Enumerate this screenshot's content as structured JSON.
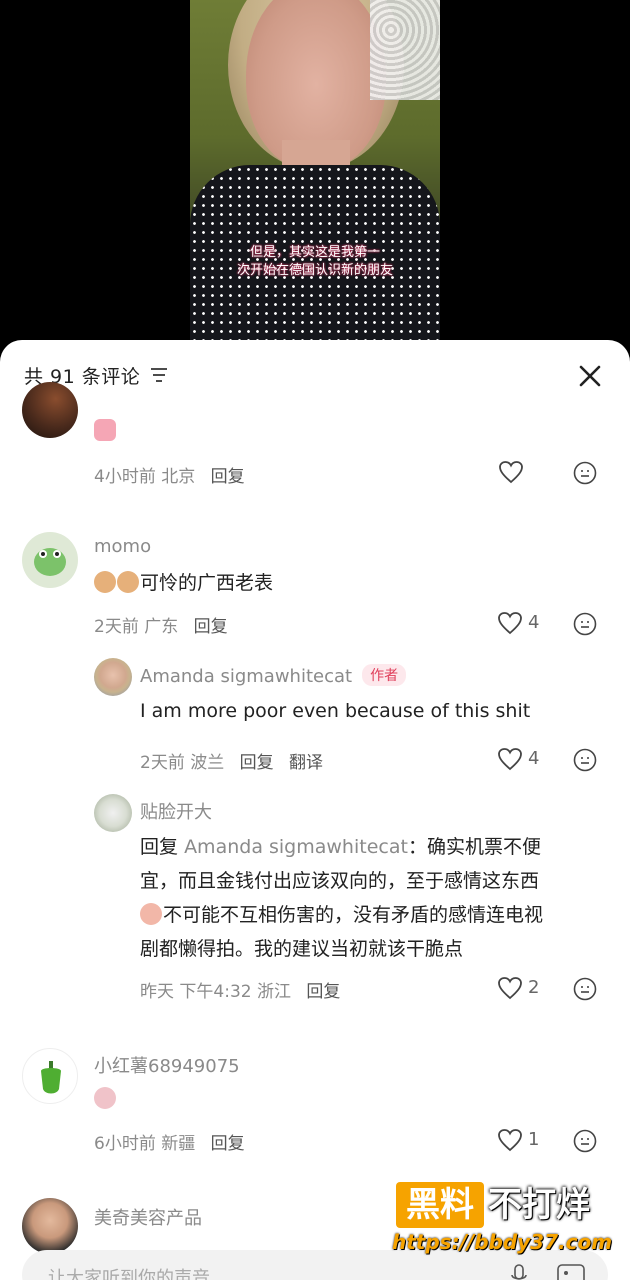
{
  "video": {
    "subtitle_line1": "但是，其实这是我第一",
    "subtitle_line2": "次开始在德国认识新的朋友"
  },
  "header": {
    "title": "共 91 条评论"
  },
  "comments": [
    {
      "meta_time_loc": "4小时前 北京",
      "reply_label": "回复"
    },
    {
      "name": "momo",
      "text": "可怜的广西老表",
      "meta_time_loc": "2天前 广东",
      "reply_label": "回复",
      "likes": "4"
    },
    {
      "name": "Amanda sigmawhitecat",
      "badge": "作者",
      "text": "I am more poor even because of this shit",
      "meta_time_loc": "2天前 波兰",
      "reply_label": "回复",
      "translate_label": "翻译",
      "likes": "4"
    },
    {
      "name": "贴脸开大",
      "reply_prefix": "回复",
      "reply_target": "Amanda sigmawhitecat",
      "text_line1_rest": "：确实机票不便",
      "text_line2": "宜，而且金钱付出应该双向的，至于感情这东西",
      "text_line3": "不可能不互相伤害的，没有矛盾的感情连电视",
      "text_line4": "剧都懒得拍。我的建议当初就该干脆点",
      "meta_time_loc": "昨天 下午4:32 浙江",
      "reply_label": "回复",
      "likes": "2"
    },
    {
      "name": "小红薯68949075",
      "meta_time_loc": "6小时前 新疆",
      "reply_label": "回复",
      "likes": "1"
    },
    {
      "name": "美奇美容产品"
    }
  ],
  "input": {
    "placeholder": "让大家听到你的声音"
  },
  "watermark": {
    "box_text": "黑料",
    "right_text": "不打烊",
    "url": "https://bbdy37.com"
  },
  "colors": {
    "accent": "#e0405c",
    "watermark_orange": "#f6a300"
  }
}
